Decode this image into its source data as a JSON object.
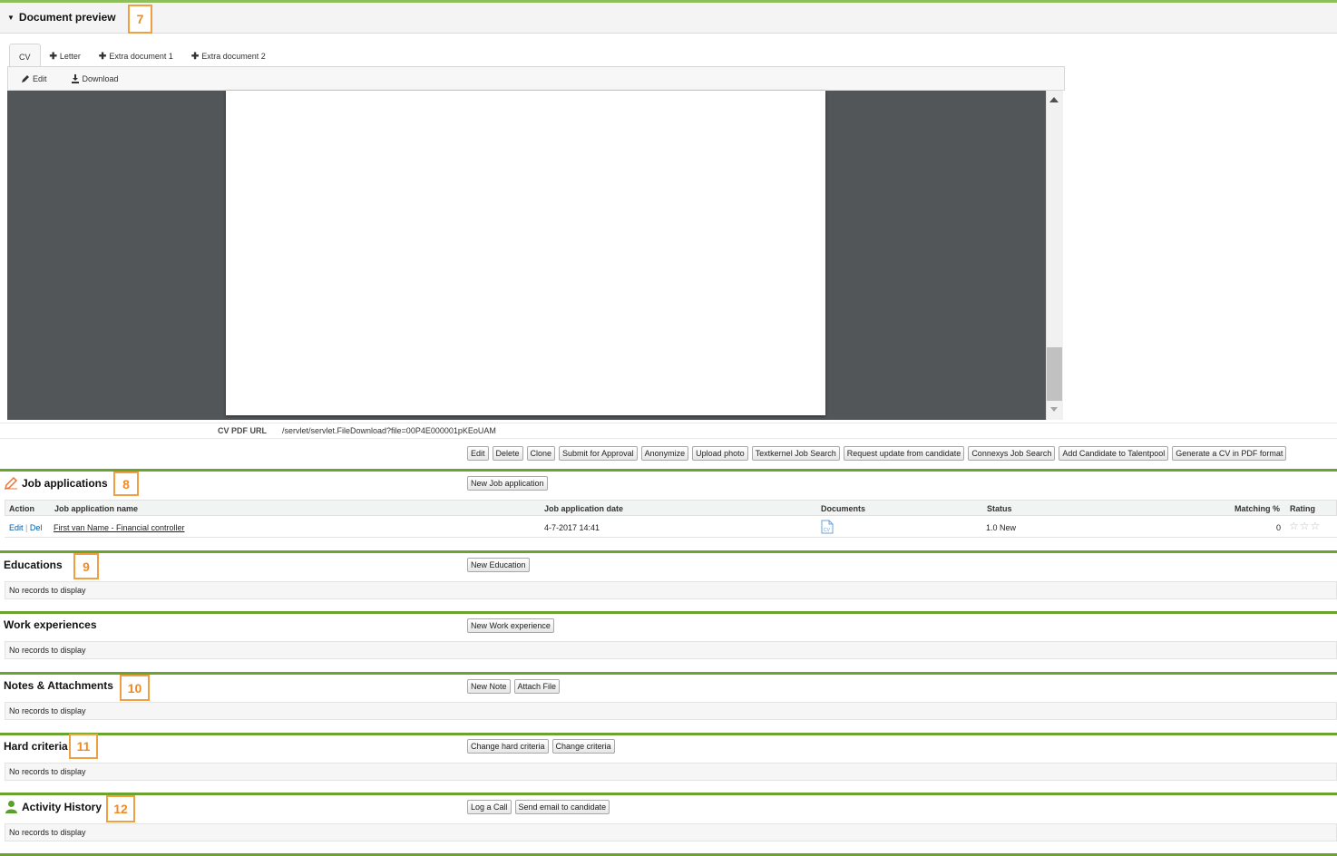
{
  "document_preview": {
    "title": "Document preview",
    "callout": "7",
    "tabs": [
      {
        "label": "CV"
      },
      {
        "label": "Letter"
      },
      {
        "label": "Extra document 1"
      },
      {
        "label": "Extra document 2"
      }
    ],
    "toolbar": {
      "edit": "Edit",
      "download": "Download"
    },
    "pdf_url_label": "CV PDF URL",
    "pdf_url_value": "/servlet/servlet.FileDownload?file=00P4E000001pKEoUAM"
  },
  "action_buttons": [
    "Edit",
    "Delete",
    "Clone",
    "Submit for Approval",
    "Anonymize",
    "Upload photo",
    "Textkernel Job Search",
    "Request update from candidate",
    "Connexys Job Search",
    "Add Candidate to Talentpool",
    "Generate a CV in PDF format"
  ],
  "job_applications": {
    "title": "Job applications",
    "callout": "8",
    "new_button": "New Job application",
    "columns": [
      "Action",
      "Job application name",
      "Job application date",
      "Documents",
      "Status",
      "Matching %",
      "Rating"
    ],
    "row": {
      "edit": "Edit",
      "sep": "|",
      "del": "Del",
      "name": "First van Name - Financial controller",
      "date": "4-7-2017 14:41",
      "doc_icon": "cv-document-icon",
      "status": "1.0 New",
      "matching": "0",
      "rating": "☆☆☆"
    }
  },
  "educations": {
    "title": "Educations",
    "callout": "9",
    "new_button": "New Education",
    "empty": "No records to display"
  },
  "work_experiences": {
    "title": "Work experiences",
    "new_button": "New Work experience",
    "empty": "No records to display"
  },
  "notes": {
    "title": "Notes & Attachments",
    "callout": "10",
    "buttons": [
      "New Note",
      "Attach File"
    ],
    "empty": "No records to display"
  },
  "hard_criteria": {
    "title": "Hard criteria",
    "callout": "11",
    "buttons": [
      "Change hard criteria",
      "Change criteria"
    ],
    "empty": "No records to display"
  },
  "activity_history": {
    "title": "Activity History",
    "callout": "12",
    "buttons": [
      "Log a Call",
      "Send email to candidate"
    ],
    "empty": "No records to display"
  },
  "colors": {
    "section_line": "#6aa32e",
    "callout": "#f08a24",
    "viewer_bg": "#525659"
  }
}
